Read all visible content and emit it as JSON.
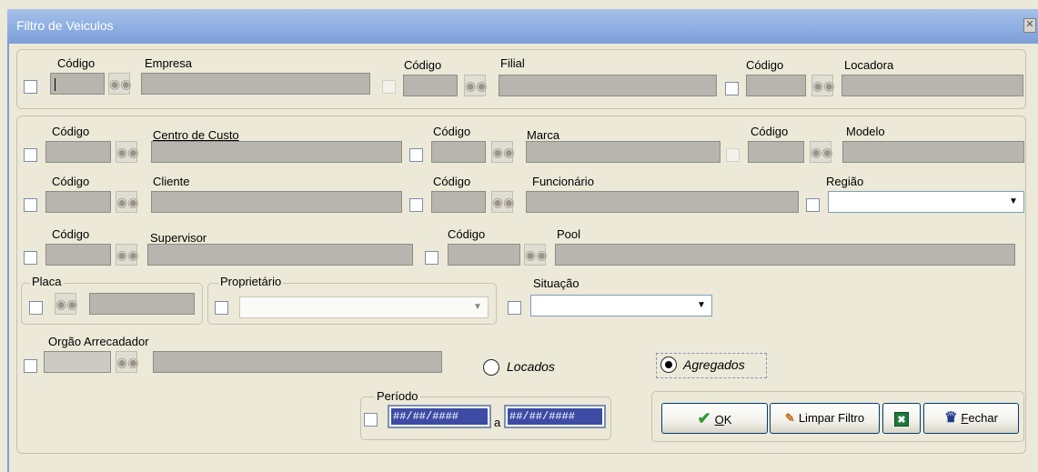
{
  "window": {
    "title": "Filtro de Veiculos",
    "close": "✕"
  },
  "labels": {
    "codigo": "Código",
    "empresa": "Empresa",
    "filial": "Filial",
    "locadora": "Locadora",
    "centro_custo": "Centro de Custo",
    "marca": "Marca",
    "modelo": "Modelo",
    "cliente": "Cliente",
    "funcionario": "Funcionário",
    "regiao": "Região",
    "supervisor": "Supervisor",
    "pool": "Pool",
    "placa": "Placa",
    "proprietario": "Proprietário",
    "situacao": "Situação",
    "orgao": "Orgão Arrecadador",
    "periodo": "Período",
    "a": "a"
  },
  "radios": {
    "locados": "Locados",
    "agregados": "Agregados",
    "selected": "agregados"
  },
  "dates": {
    "start": "##/##/####",
    "end": "##/##/####"
  },
  "buttons": {
    "ok_key": "O",
    "ok_rest": "K",
    "limpar": "Limpar Filtro",
    "fechar_key": "F",
    "fechar_rest": "echar"
  },
  "icons": {
    "search": "binoculars-icon",
    "ok": "checkmark-icon",
    "clear": "eraser-icon",
    "excel": "excel-icon",
    "close": "door-exit-icon"
  },
  "colors": {
    "window_bg": "#ece9d8",
    "title_bar": "#8fb0e3",
    "field_disabled": "#b6b5ae",
    "date_highlight": "#3d4ba5",
    "ok_check": "#2e9a2e"
  }
}
